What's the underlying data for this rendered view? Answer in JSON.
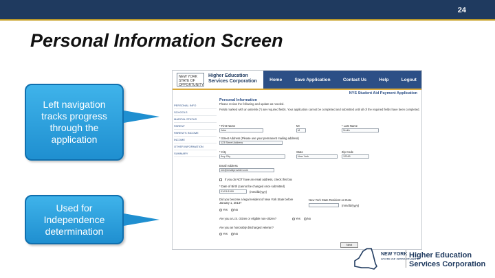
{
  "slide": {
    "number": "24",
    "title": "Personal Information Screen",
    "callouts": [
      "Left navigation tracks progress through the application",
      "Used for Independence determination"
    ],
    "colors": {
      "bar": "#1f3a5f",
      "callout": "#2a9fde"
    }
  },
  "screenshot": {
    "org_name_line1": "Higher Education",
    "org_name_line2": "Services Corporation",
    "logo_text": "NEW YORK STATE OF OPPORTUNITY",
    "nav": [
      "Home",
      "Save Application",
      "Contact Us",
      "Help",
      "Logout"
    ],
    "form_title": "NYS Student Aid Payment Application",
    "section_title": "Personal Information",
    "intro_1": "Please review the following and update as needed.",
    "intro_2": "Fields marked with an asterisk (*) are required fields. Your application cannot be completed and submitted until all of the required fields have been completed.",
    "left_nav": [
      "Personal Info",
      "Schools",
      "Marital Status",
      "Parent",
      "Parents Income",
      "Income",
      "Other Information",
      "Summary"
    ],
    "fields": {
      "first_name_label": "* First Name",
      "first_name": "John",
      "mi_label": "MI",
      "mi": "M",
      "last_name_label": "* Last Name",
      "last_name": "Smith",
      "street_label": "* Street Address (Please use your permanent mailing address)",
      "street": "123 Street Address",
      "city_label": "* City",
      "city": "Any City",
      "state_label": "State",
      "state": "New York",
      "zip_label": "Zip Code",
      "zip": "12345",
      "email_label": "Email Address",
      "email": "me@emailprovider.com",
      "no_email_label": "If you do NOT have an email address, check this box",
      "dob_label": "* Date of Birth (cannot be changed once submitted)",
      "dob": "01/01/1999",
      "dob_format": "(mm/dd/yyyy)",
      "resident_label": "Did you become a legal resident of New York State before January 1, 2013?",
      "resident_date_label": "New York State Resident on Date",
      "resident_format": "(mm/dd/yyyy)",
      "yes": "Yes",
      "no": "No",
      "citizen_label": "Are you a U.S. citizen or eligible non-citizen?",
      "veteran_label": "Are you an honorably discharged veteran?",
      "next_button": "Next"
    }
  },
  "footer": {
    "state_name": "NEW YORK",
    "state_tag": "STATE OF OPPORTUNITY.",
    "org_line1": "Higher Education",
    "org_line2": "Services Corporation"
  }
}
